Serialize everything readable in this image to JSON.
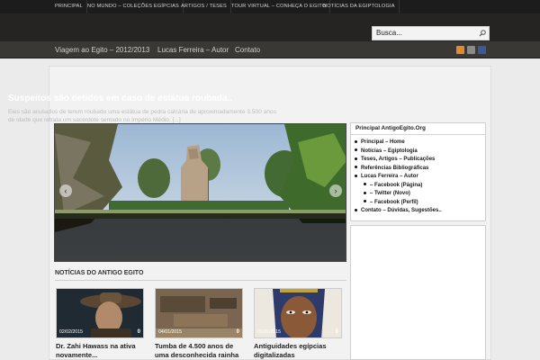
{
  "topnav": [
    "Principal",
    "No mundo – Coleções Egípcias",
    "Artigos / Teses",
    "Tour Virtual – Conheça o Egito",
    "Notícias da Egiptologia"
  ],
  "search": {
    "placeholder": "Busca..."
  },
  "mainnav": [
    "Viagem ao Egito – 2012/2013",
    "Lucas Ferreira – Autor",
    "Contato"
  ],
  "social_icons": [
    "rss-icon",
    "email-icon",
    "facebook-icon"
  ],
  "slider": {
    "title": "Suspeitos são detidos em caso de estátua roubada..",
    "text": "Eles são acusados de terem roubado uma estátua de pedra calcária de aproximadamente 3.500 anos de idade que retrata um sacerdote sentado no Império Médio. [...]",
    "prev_icon": "‹",
    "next_icon": "›"
  },
  "news_section_title": "Notícias do Antigo Egito",
  "cards": [
    {
      "date": "02/02/2015",
      "comments": "0",
      "title": "Dr. Zahi Hawass na ativa novamente..."
    },
    {
      "date": "04/01/2015",
      "comments": "0",
      "title": "Tumba de 4.500 anos de uma desconhecida rainha"
    },
    {
      "date": "06/01/2015",
      "comments": "0",
      "title": "Antiguidades egípcias digitalizadas"
    }
  ],
  "sidebar": {
    "title": "Principal AntigoEgito.Org",
    "items": [
      "Principal – Home",
      "Notícias – Egiptologia",
      "Teses, Artigos – Publicações",
      "Referências Bibliográficas",
      "Lucas Ferreira – Autor",
      "– Facebook (Página)",
      "– Twitter (Novo)",
      "– Facebook (Perfil)",
      "Contato – Dúvidas, Sugestões.."
    ]
  },
  "colors": {
    "topbar": "#1c1c1c",
    "header": "#262422",
    "mainnav": "#3a3835",
    "background": "#ebebeb"
  }
}
